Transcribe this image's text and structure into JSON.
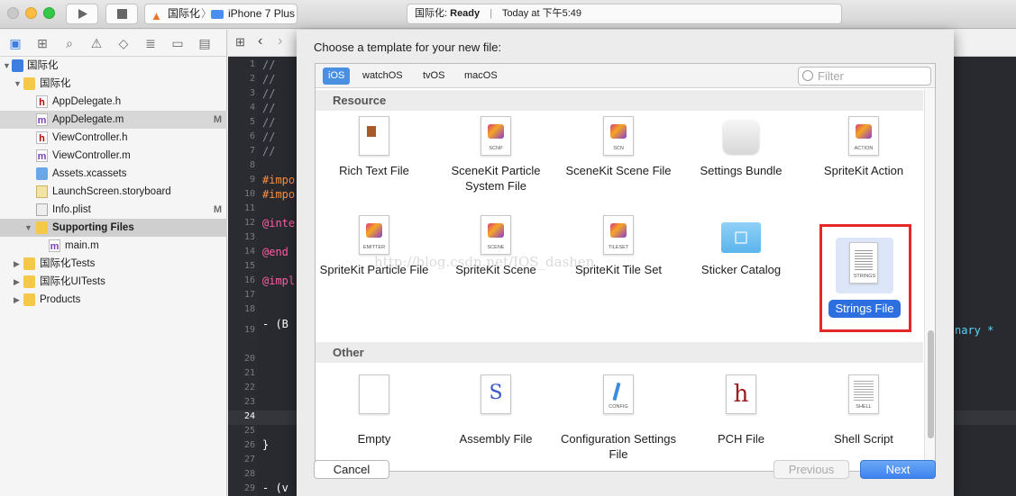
{
  "toolbar": {
    "scheme_project": "国际化",
    "scheme_device": "iPhone 7 Plus",
    "status_project": "国际化:",
    "status_state": "Ready",
    "status_sep": "|",
    "status_time": "Today at 下午5:49"
  },
  "navigator": {
    "items": [
      {
        "label": "国际化",
        "icon": "project-icon"
      },
      {
        "label": "国际化",
        "icon": "folder-icon"
      },
      {
        "label": "AppDelegate.h",
        "icon": "h-file-icon"
      },
      {
        "label": "AppDelegate.m",
        "icon": "m-file-icon",
        "badge": "M"
      },
      {
        "label": "ViewController.h",
        "icon": "h-file-icon"
      },
      {
        "label": "ViewController.m",
        "icon": "m-file-icon"
      },
      {
        "label": "Assets.xcassets",
        "icon": "assets-icon"
      },
      {
        "label": "LaunchScreen.storyboard",
        "icon": "storyboard-icon"
      },
      {
        "label": "Info.plist",
        "icon": "plist-icon",
        "badge": "M"
      },
      {
        "label": "Supporting Files",
        "icon": "folder-icon"
      },
      {
        "label": "main.m",
        "icon": "m-file-icon"
      },
      {
        "label": "国际化Tests",
        "icon": "folder-icon"
      },
      {
        "label": "国际化UITests",
        "icon": "folder-icon"
      },
      {
        "label": "Products",
        "icon": "folder-icon"
      }
    ]
  },
  "editor": {
    "line_numbers": [
      "1",
      "2",
      "3",
      "4",
      "5",
      "6",
      "7",
      "8",
      "9",
      "10",
      "11",
      "12",
      "13",
      "14",
      "15",
      "16",
      "17",
      "18",
      "19",
      "20",
      "21",
      "22",
      "23",
      "24",
      "25",
      "26",
      "27",
      "28",
      "29"
    ],
    "visible_code": [
      "//",
      "//",
      "//",
      "//",
      "//",
      "//",
      "//",
      "#impo",
      "#impo",
      "@inte",
      "@end",
      "@impl",
      "- (B",
      "}",
      "- (v",
      "nary *"
    ]
  },
  "dialog": {
    "title": "Choose a template for your new file:",
    "tabs": [
      "iOS",
      "watchOS",
      "tvOS",
      "macOS"
    ],
    "filter_placeholder": "Filter",
    "sections": {
      "resource": "Resource",
      "other": "Other"
    },
    "resource_items": [
      {
        "name": "Rich Text File",
        "icon": "rich-text-file-icon"
      },
      {
        "name": "SceneKit Particle System File",
        "icon": "scenekit-particle-icon",
        "tag": "SCNP"
      },
      {
        "name": "SceneKit Scene File",
        "icon": "scenekit-scene-icon",
        "tag": "SCN"
      },
      {
        "name": "Settings Bundle",
        "icon": "settings-bundle-icon"
      },
      {
        "name": "SpriteKit Action",
        "icon": "spritekit-action-icon",
        "tag": "ACTION"
      },
      {
        "name": "SpriteKit Particle File",
        "icon": "spritekit-particle-icon",
        "tag": "EMITTER"
      },
      {
        "name": "SpriteKit Scene",
        "icon": "spritekit-scene-icon",
        "tag": "SCENE"
      },
      {
        "name": "SpriteKit Tile Set",
        "icon": "spritekit-tileset-icon",
        "tag": "TILESET"
      },
      {
        "name": "Sticker Catalog",
        "icon": "sticker-catalog-icon"
      },
      {
        "name": "Strings File",
        "icon": "strings-file-icon",
        "tag": "STRINGS"
      }
    ],
    "other_items": [
      {
        "name": "Empty",
        "icon": "empty-file-icon"
      },
      {
        "name": "Assembly File",
        "icon": "assembly-file-icon",
        "glyph": "S"
      },
      {
        "name": "Configuration Settings File",
        "icon": "config-file-icon",
        "tag": "CONFIG"
      },
      {
        "name": "PCH File",
        "icon": "pch-file-icon",
        "glyph": "h"
      },
      {
        "name": "Shell Script",
        "icon": "shell-script-icon",
        "tag": "SHELL"
      }
    ],
    "buttons": {
      "cancel": "Cancel",
      "previous": "Previous",
      "next": "Next"
    }
  },
  "watermark": "http://blog.csdn.net/IOS_dashen"
}
